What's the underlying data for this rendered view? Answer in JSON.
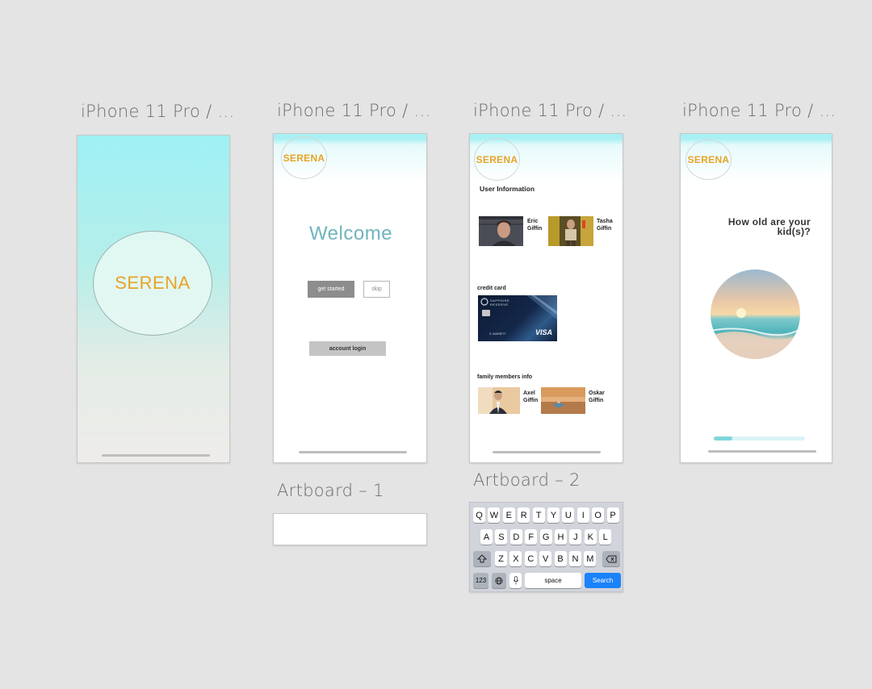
{
  "artboards": {
    "a1_title": "iPhone 11 Pro / ...",
    "a2_title": "iPhone 11 Pro / ...",
    "a3_title": "iPhone 11 Pro / ...",
    "a4_title": "iPhone 11 Pro / ...",
    "artboard1_title": "Artboard – 1",
    "artboard2_title": "Artboard – 2"
  },
  "splash": {
    "logo": "SERENA"
  },
  "welcome": {
    "logo": "SERENA",
    "heading": "Welcome",
    "get_started": "get started",
    "skip": "skip",
    "account_login": "account login"
  },
  "user_info": {
    "logo": "SERENA",
    "heading": "User Information",
    "users": [
      {
        "first": "Eric",
        "last": "Giffin"
      },
      {
        "first": "Tasha",
        "last": "Giffin"
      }
    ],
    "credit_card_label": "credit card",
    "card": {
      "bank": "SAPPHIRE",
      "bank_sub": "RESERVE",
      "holder": "S. BARRETT",
      "brand": "VISA"
    },
    "family_label": "family members info",
    "family": [
      {
        "first": "Axel",
        "last": "Giffin"
      },
      {
        "first": "Oskar",
        "last": "Giffin"
      }
    ]
  },
  "kids": {
    "logo": "SERENA",
    "question_line1": "How old are your",
    "question_line2": "kid(s)?",
    "progress": 0.2
  },
  "keyboard": {
    "row1": [
      "Q",
      "W",
      "E",
      "R",
      "T",
      "Y",
      "U",
      "I",
      "O",
      "P"
    ],
    "row2": [
      "A",
      "S",
      "D",
      "F",
      "G",
      "H",
      "J",
      "K",
      "L"
    ],
    "row3": [
      "Z",
      "X",
      "C",
      "V",
      "B",
      "N",
      "M"
    ],
    "numbers_key": "123",
    "space_key": "space",
    "search_key": "Search",
    "accent_color": "#1a82fb"
  },
  "colors": {
    "canvas": "#e4e4e4",
    "brand_orange": "#e8a327",
    "welcome_teal": "#6fb4bd",
    "progress_fill": "#7fd6dc"
  }
}
